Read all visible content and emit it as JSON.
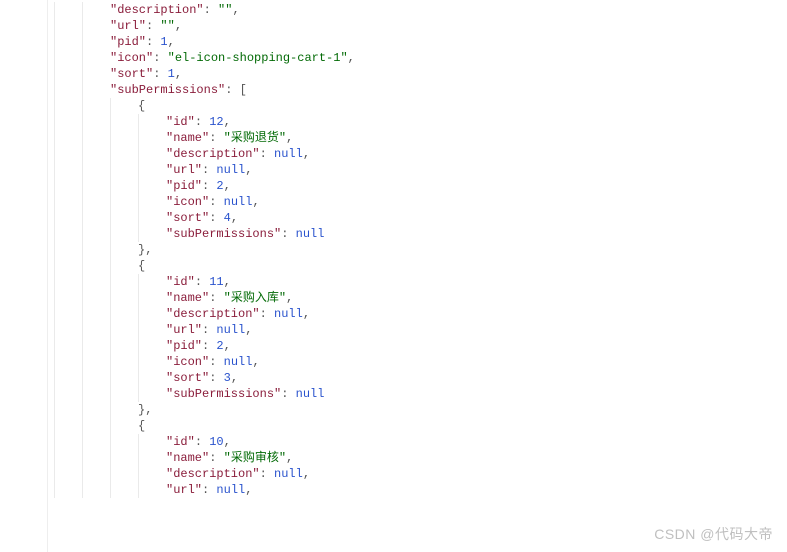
{
  "watermark": "CSDN @代码大帝",
  "code": {
    "lines": [
      {
        "indent": 2,
        "tokens": [
          {
            "t": "key",
            "v": "\"description\""
          },
          {
            "t": "punc",
            "v": ": "
          },
          {
            "t": "str",
            "v": "\"\""
          },
          {
            "t": "punc",
            "v": ","
          }
        ]
      },
      {
        "indent": 2,
        "tokens": [
          {
            "t": "key",
            "v": "\"url\""
          },
          {
            "t": "punc",
            "v": ": "
          },
          {
            "t": "str",
            "v": "\"\""
          },
          {
            "t": "punc",
            "v": ","
          }
        ]
      },
      {
        "indent": 2,
        "tokens": [
          {
            "t": "key",
            "v": "\"pid\""
          },
          {
            "t": "punc",
            "v": ": "
          },
          {
            "t": "num",
            "v": "1"
          },
          {
            "t": "punc",
            "v": ","
          }
        ]
      },
      {
        "indent": 2,
        "tokens": [
          {
            "t": "key",
            "v": "\"icon\""
          },
          {
            "t": "punc",
            "v": ": "
          },
          {
            "t": "str",
            "v": "\"el-icon-shopping-cart-1\""
          },
          {
            "t": "punc",
            "v": ","
          }
        ]
      },
      {
        "indent": 2,
        "tokens": [
          {
            "t": "key",
            "v": "\"sort\""
          },
          {
            "t": "punc",
            "v": ": "
          },
          {
            "t": "num",
            "v": "1"
          },
          {
            "t": "punc",
            "v": ","
          }
        ]
      },
      {
        "indent": 2,
        "tokens": [
          {
            "t": "key",
            "v": "\"subPermissions\""
          },
          {
            "t": "punc",
            "v": ": ["
          }
        ]
      },
      {
        "indent": 3,
        "tokens": [
          {
            "t": "brace",
            "v": "{"
          }
        ]
      },
      {
        "indent": 4,
        "tokens": [
          {
            "t": "key",
            "v": "\"id\""
          },
          {
            "t": "punc",
            "v": ": "
          },
          {
            "t": "num",
            "v": "12"
          },
          {
            "t": "punc",
            "v": ","
          }
        ]
      },
      {
        "indent": 4,
        "tokens": [
          {
            "t": "key",
            "v": "\"name\""
          },
          {
            "t": "punc",
            "v": ": "
          },
          {
            "t": "str",
            "v": "\"采购退货\""
          },
          {
            "t": "punc",
            "v": ","
          }
        ]
      },
      {
        "indent": 4,
        "tokens": [
          {
            "t": "key",
            "v": "\"description\""
          },
          {
            "t": "punc",
            "v": ": "
          },
          {
            "t": "null",
            "v": "null"
          },
          {
            "t": "punc",
            "v": ","
          }
        ]
      },
      {
        "indent": 4,
        "tokens": [
          {
            "t": "key",
            "v": "\"url\""
          },
          {
            "t": "punc",
            "v": ": "
          },
          {
            "t": "null",
            "v": "null"
          },
          {
            "t": "punc",
            "v": ","
          }
        ]
      },
      {
        "indent": 4,
        "tokens": [
          {
            "t": "key",
            "v": "\"pid\""
          },
          {
            "t": "punc",
            "v": ": "
          },
          {
            "t": "num",
            "v": "2"
          },
          {
            "t": "punc",
            "v": ","
          }
        ]
      },
      {
        "indent": 4,
        "tokens": [
          {
            "t": "key",
            "v": "\"icon\""
          },
          {
            "t": "punc",
            "v": ": "
          },
          {
            "t": "null",
            "v": "null"
          },
          {
            "t": "punc",
            "v": ","
          }
        ]
      },
      {
        "indent": 4,
        "tokens": [
          {
            "t": "key",
            "v": "\"sort\""
          },
          {
            "t": "punc",
            "v": ": "
          },
          {
            "t": "num",
            "v": "4"
          },
          {
            "t": "punc",
            "v": ","
          }
        ]
      },
      {
        "indent": 4,
        "tokens": [
          {
            "t": "key",
            "v": "\"subPermissions\""
          },
          {
            "t": "punc",
            "v": ": "
          },
          {
            "t": "null",
            "v": "null"
          }
        ]
      },
      {
        "indent": 3,
        "tokens": [
          {
            "t": "brace",
            "v": "},"
          }
        ]
      },
      {
        "indent": 3,
        "tokens": [
          {
            "t": "brace",
            "v": "{"
          }
        ]
      },
      {
        "indent": 4,
        "tokens": [
          {
            "t": "key",
            "v": "\"id\""
          },
          {
            "t": "punc",
            "v": ": "
          },
          {
            "t": "num",
            "v": "11"
          },
          {
            "t": "punc",
            "v": ","
          }
        ]
      },
      {
        "indent": 4,
        "tokens": [
          {
            "t": "key",
            "v": "\"name\""
          },
          {
            "t": "punc",
            "v": ": "
          },
          {
            "t": "str",
            "v": "\"采购入库\""
          },
          {
            "t": "punc",
            "v": ","
          }
        ]
      },
      {
        "indent": 4,
        "tokens": [
          {
            "t": "key",
            "v": "\"description\""
          },
          {
            "t": "punc",
            "v": ": "
          },
          {
            "t": "null",
            "v": "null"
          },
          {
            "t": "punc",
            "v": ","
          }
        ]
      },
      {
        "indent": 4,
        "tokens": [
          {
            "t": "key",
            "v": "\"url\""
          },
          {
            "t": "punc",
            "v": ": "
          },
          {
            "t": "null",
            "v": "null"
          },
          {
            "t": "punc",
            "v": ","
          }
        ]
      },
      {
        "indent": 4,
        "tokens": [
          {
            "t": "key",
            "v": "\"pid\""
          },
          {
            "t": "punc",
            "v": ": "
          },
          {
            "t": "num",
            "v": "2"
          },
          {
            "t": "punc",
            "v": ","
          }
        ]
      },
      {
        "indent": 4,
        "tokens": [
          {
            "t": "key",
            "v": "\"icon\""
          },
          {
            "t": "punc",
            "v": ": "
          },
          {
            "t": "null",
            "v": "null"
          },
          {
            "t": "punc",
            "v": ","
          }
        ]
      },
      {
        "indent": 4,
        "tokens": [
          {
            "t": "key",
            "v": "\"sort\""
          },
          {
            "t": "punc",
            "v": ": "
          },
          {
            "t": "num",
            "v": "3"
          },
          {
            "t": "punc",
            "v": ","
          }
        ]
      },
      {
        "indent": 4,
        "tokens": [
          {
            "t": "key",
            "v": "\"subPermissions\""
          },
          {
            "t": "punc",
            "v": ": "
          },
          {
            "t": "null",
            "v": "null"
          }
        ]
      },
      {
        "indent": 3,
        "tokens": [
          {
            "t": "brace",
            "v": "},"
          }
        ]
      },
      {
        "indent": 3,
        "tokens": [
          {
            "t": "brace",
            "v": "{"
          }
        ]
      },
      {
        "indent": 4,
        "tokens": [
          {
            "t": "key",
            "v": "\"id\""
          },
          {
            "t": "punc",
            "v": ": "
          },
          {
            "t": "num",
            "v": "10"
          },
          {
            "t": "punc",
            "v": ","
          }
        ]
      },
      {
        "indent": 4,
        "tokens": [
          {
            "t": "key",
            "v": "\"name\""
          },
          {
            "t": "punc",
            "v": ": "
          },
          {
            "t": "str",
            "v": "\"采购审核\""
          },
          {
            "t": "punc",
            "v": ","
          }
        ]
      },
      {
        "indent": 4,
        "tokens": [
          {
            "t": "key",
            "v": "\"description\""
          },
          {
            "t": "punc",
            "v": ": "
          },
          {
            "t": "null",
            "v": "null"
          },
          {
            "t": "punc",
            "v": ","
          }
        ]
      },
      {
        "indent": 4,
        "tokens": [
          {
            "t": "key",
            "v": "\"url\""
          },
          {
            "t": "punc",
            "v": ": "
          },
          {
            "t": "null",
            "v": "null"
          },
          {
            "t": "punc",
            "v": ","
          }
        ]
      }
    ]
  }
}
